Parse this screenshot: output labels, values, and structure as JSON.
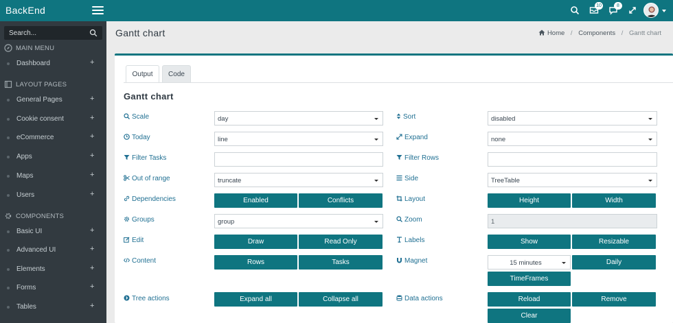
{
  "app": {
    "brand": "BackEnd"
  },
  "topbar": {
    "messages_badge": "10",
    "chat_badge": "8"
  },
  "sidebar": {
    "search_placeholder": "Search...",
    "sections": [
      {
        "label": "MAIN MENU",
        "icon": "compass-icon"
      },
      {
        "label": "LAYOUT PAGES",
        "icon": "book-icon"
      },
      {
        "label": "COMPONENTS",
        "icon": "gear-icon"
      }
    ],
    "items": [
      {
        "label": "Dashboard"
      },
      {
        "label": "General Pages"
      },
      {
        "label": "Cookie consent"
      },
      {
        "label": "eCommerce"
      },
      {
        "label": "Apps"
      },
      {
        "label": "Maps"
      },
      {
        "label": "Users"
      },
      {
        "label": "Basic UI"
      },
      {
        "label": "Advanced UI"
      },
      {
        "label": "Elements"
      },
      {
        "label": "Forms"
      },
      {
        "label": "Tables"
      }
    ],
    "plus": "+"
  },
  "page": {
    "title": "Gantt chart",
    "breadcrumb": [
      "Home",
      "Components",
      "Gantt chart"
    ],
    "breadcrumb_sep": "/"
  },
  "card": {
    "tabs": [
      "Output",
      "Code"
    ],
    "title": "Gantt chart"
  },
  "form": {
    "scale": {
      "label": "Scale",
      "value": "day"
    },
    "today": {
      "label": "Today",
      "value": "line"
    },
    "filter_tasks": {
      "label": "Filter Tasks",
      "value": ""
    },
    "out_of_range": {
      "label": "Out of range",
      "value": "truncate"
    },
    "dependencies": {
      "label": "Dependencies",
      "buttons": [
        "Enabled",
        "Conflicts"
      ]
    },
    "groups": {
      "label": "Groups",
      "value": "group"
    },
    "edit": {
      "label": "Edit",
      "buttons": [
        "Draw",
        "Read Only"
      ]
    },
    "content": {
      "label": "Content",
      "buttons": [
        "Rows",
        "Tasks"
      ]
    },
    "tree_actions": {
      "label": "Tree actions",
      "buttons": [
        "Expand all",
        "Collapse all"
      ]
    },
    "sort": {
      "label": "Sort",
      "value": "disabled"
    },
    "expand": {
      "label": "Expand",
      "value": "none"
    },
    "filter_rows": {
      "label": "Filter Rows",
      "value": ""
    },
    "side": {
      "label": "Side",
      "value": "TreeTable"
    },
    "layout": {
      "label": "Layout",
      "buttons": [
        "Height",
        "Width"
      ]
    },
    "zoom": {
      "label": "Zoom",
      "value": "1"
    },
    "labels": {
      "label": "Labels",
      "buttons": [
        "Show",
        "Resizable"
      ]
    },
    "magnet": {
      "label": "Magnet",
      "value": "15 minutes",
      "buttons": [
        "Daily",
        "TimeFrames"
      ]
    },
    "data_actions": {
      "label": "Data actions",
      "buttons": [
        "Reload",
        "Remove",
        "Clear"
      ]
    }
  },
  "colors": {
    "accent": "#0f7580",
    "sidebar": "#323a40",
    "label": "#1f6f92"
  }
}
